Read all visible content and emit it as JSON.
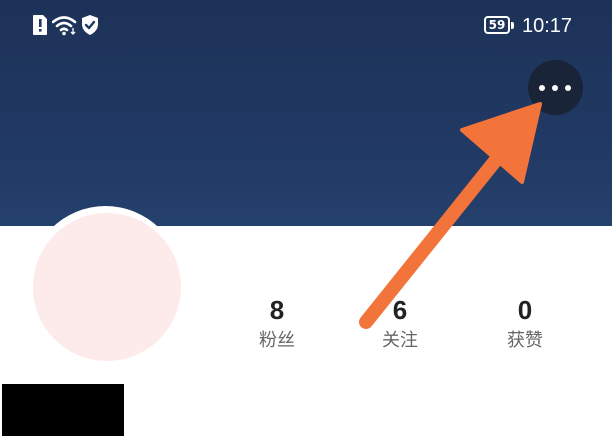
{
  "colors": {
    "header_background": "#203862",
    "accent_arrow": "#f2743a",
    "avatar_placeholder": "#fdeaea",
    "stat_value": "#222222",
    "stat_label": "#666666"
  },
  "status_bar": {
    "icons": [
      "notification-alert-icon",
      "wifi-icon",
      "shield-check-icon"
    ],
    "battery_level": "59",
    "time": "10:17"
  },
  "header": {
    "more_button_icon": "more-horizontal-icon"
  },
  "profile": {
    "stats": [
      {
        "value": "8",
        "label": "粉丝"
      },
      {
        "value": "6",
        "label": "关注"
      },
      {
        "value": "0",
        "label": "获赞"
      }
    ]
  },
  "annotation": {
    "arrow_icon": "pointer-arrow-icon"
  }
}
